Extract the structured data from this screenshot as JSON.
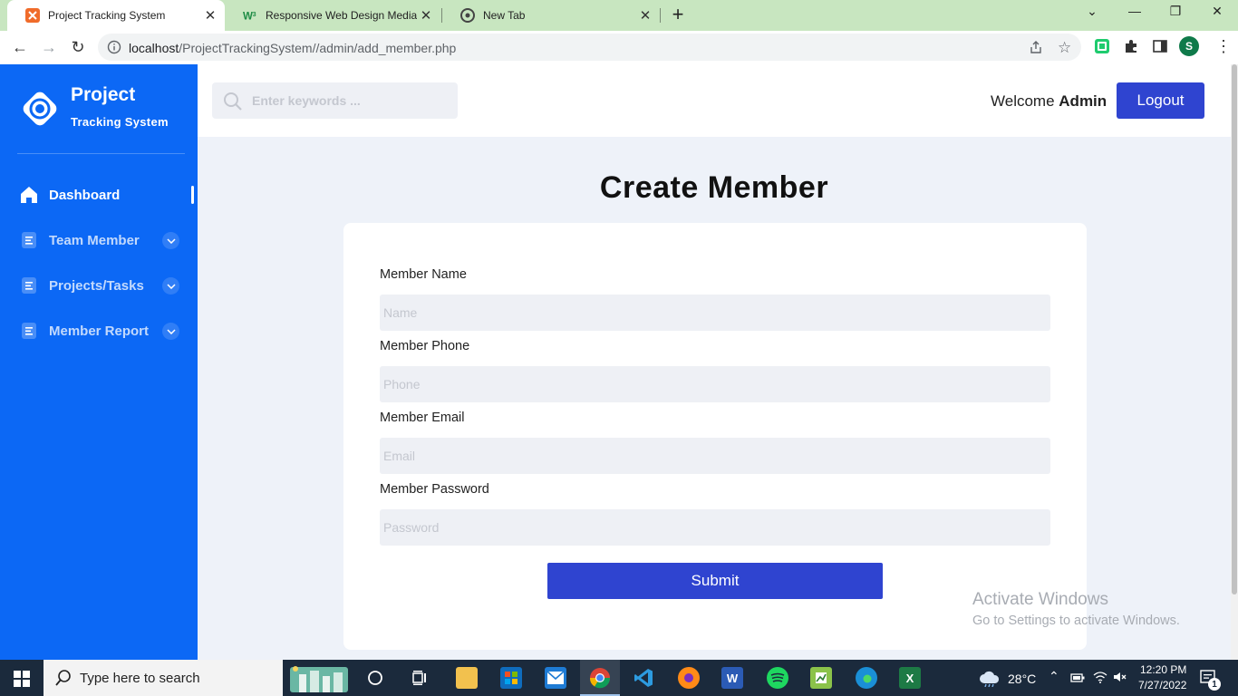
{
  "browser": {
    "tabs": [
      {
        "title": "Project Tracking System",
        "active": true
      },
      {
        "title": "Responsive Web Design Media Q",
        "active": false
      },
      {
        "title": "New Tab",
        "active": false
      }
    ],
    "url_host": "localhost",
    "url_path": "/ProjectTrackingSystem//admin/add_member.php",
    "profile_initial": "S"
  },
  "sidebar": {
    "brand_title": "Project",
    "brand_subtitle": "Tracking System",
    "items": [
      {
        "label": "Dashboard",
        "icon": "home-icon",
        "active": true
      },
      {
        "label": "Team Member",
        "icon": "list-icon",
        "active": false
      },
      {
        "label": "Projects/Tasks",
        "icon": "list-icon",
        "active": false
      },
      {
        "label": "Member Report",
        "icon": "list-icon",
        "active": false
      }
    ]
  },
  "topbar": {
    "search_placeholder": "Enter keywords ...",
    "welcome_text": "Welcome",
    "welcome_user": "Admin",
    "logout_label": "Logout"
  },
  "form": {
    "title": "Create Member",
    "fields": [
      {
        "label": "Member Name",
        "placeholder": "Name",
        "value": ""
      },
      {
        "label": "Member Phone",
        "placeholder": "Phone",
        "value": ""
      },
      {
        "label": "Member Email",
        "placeholder": "Email",
        "value": ""
      },
      {
        "label": "Member Password",
        "placeholder": "Password",
        "value": ""
      }
    ],
    "submit_label": "Submit"
  },
  "watermark": {
    "line1": "Activate Windows",
    "line2": "Go to Settings to activate Windows."
  },
  "taskbar": {
    "search_text": "Type here to search",
    "weather": "28°C",
    "time": "12:20 PM",
    "date": "7/27/2022",
    "notification_count": "1"
  },
  "colors": {
    "sidebar": "#0c68f5",
    "primary_button": "#2f44d0",
    "page_bg": "#eef2f9",
    "tab_strip": "#c8e6c0"
  }
}
